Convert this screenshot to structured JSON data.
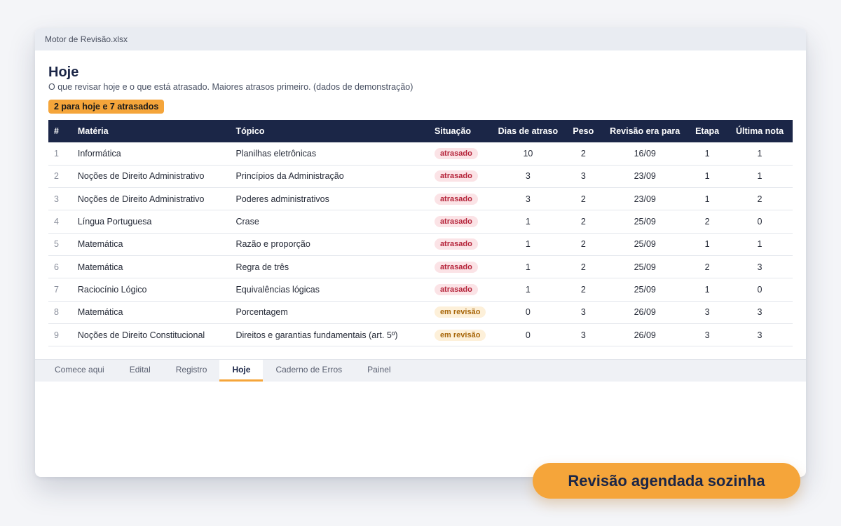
{
  "window": {
    "title": "Motor de Revisão.xlsx"
  },
  "header": {
    "title": "Hoje",
    "subtitle": "O que revisar hoje e o que está atrasado. Maiores atrasos primeiro. (dados de demonstração)",
    "badge": "2 para hoje e 7 atrasados"
  },
  "table": {
    "columns": [
      "#",
      "Matéria",
      "Tópico",
      "Situação",
      "Dias de atraso",
      "Peso",
      "Revisão era para",
      "Etapa",
      "Última nota"
    ],
    "rows": [
      {
        "n": "1",
        "materia": "Informática",
        "topico": "Planilhas eletrônicas",
        "situacao": "atrasado",
        "dias": "10",
        "peso": "2",
        "data": "16/09",
        "etapa": "1",
        "nota": "1"
      },
      {
        "n": "2",
        "materia": "Noções de Direito Administrativo",
        "topico": "Princípios da Administração",
        "situacao": "atrasado",
        "dias": "3",
        "peso": "3",
        "data": "23/09",
        "etapa": "1",
        "nota": "1"
      },
      {
        "n": "3",
        "materia": "Noções de Direito Administrativo",
        "topico": "Poderes administrativos",
        "situacao": "atrasado",
        "dias": "3",
        "peso": "2",
        "data": "23/09",
        "etapa": "1",
        "nota": "2"
      },
      {
        "n": "4",
        "materia": "Língua Portuguesa",
        "topico": "Crase",
        "situacao": "atrasado",
        "dias": "1",
        "peso": "2",
        "data": "25/09",
        "etapa": "2",
        "nota": "0"
      },
      {
        "n": "5",
        "materia": "Matemática",
        "topico": "Razão e proporção",
        "situacao": "atrasado",
        "dias": "1",
        "peso": "2",
        "data": "25/09",
        "etapa": "1",
        "nota": "1"
      },
      {
        "n": "6",
        "materia": "Matemática",
        "topico": "Regra de três",
        "situacao": "atrasado",
        "dias": "1",
        "peso": "2",
        "data": "25/09",
        "etapa": "2",
        "nota": "3"
      },
      {
        "n": "7",
        "materia": "Raciocínio Lógico",
        "topico": "Equivalências lógicas",
        "situacao": "atrasado",
        "dias": "1",
        "peso": "2",
        "data": "25/09",
        "etapa": "1",
        "nota": "0"
      },
      {
        "n": "8",
        "materia": "Matemática",
        "topico": "Porcentagem",
        "situacao": "em revisão",
        "dias": "0",
        "peso": "3",
        "data": "26/09",
        "etapa": "3",
        "nota": "3"
      },
      {
        "n": "9",
        "materia": "Noções de Direito Constitucional",
        "topico": "Direitos e garantias fundamentais (art. 5º)",
        "situacao": "em revisão",
        "dias": "0",
        "peso": "3",
        "data": "26/09",
        "etapa": "3",
        "nota": "3"
      }
    ]
  },
  "tabs": [
    {
      "label": "Comece aqui",
      "active": false
    },
    {
      "label": "Edital",
      "active": false
    },
    {
      "label": "Registro",
      "active": false
    },
    {
      "label": "Hoje",
      "active": true
    },
    {
      "label": "Caderno de Erros",
      "active": false
    },
    {
      "label": "Painel",
      "active": false
    }
  ],
  "cta": {
    "label": "Revisão agendada sozinha"
  },
  "colors": {
    "accent": "#f5a53a",
    "header_bg": "#1b2647",
    "late_text": "#b5243a",
    "review_text": "#a8670b"
  }
}
